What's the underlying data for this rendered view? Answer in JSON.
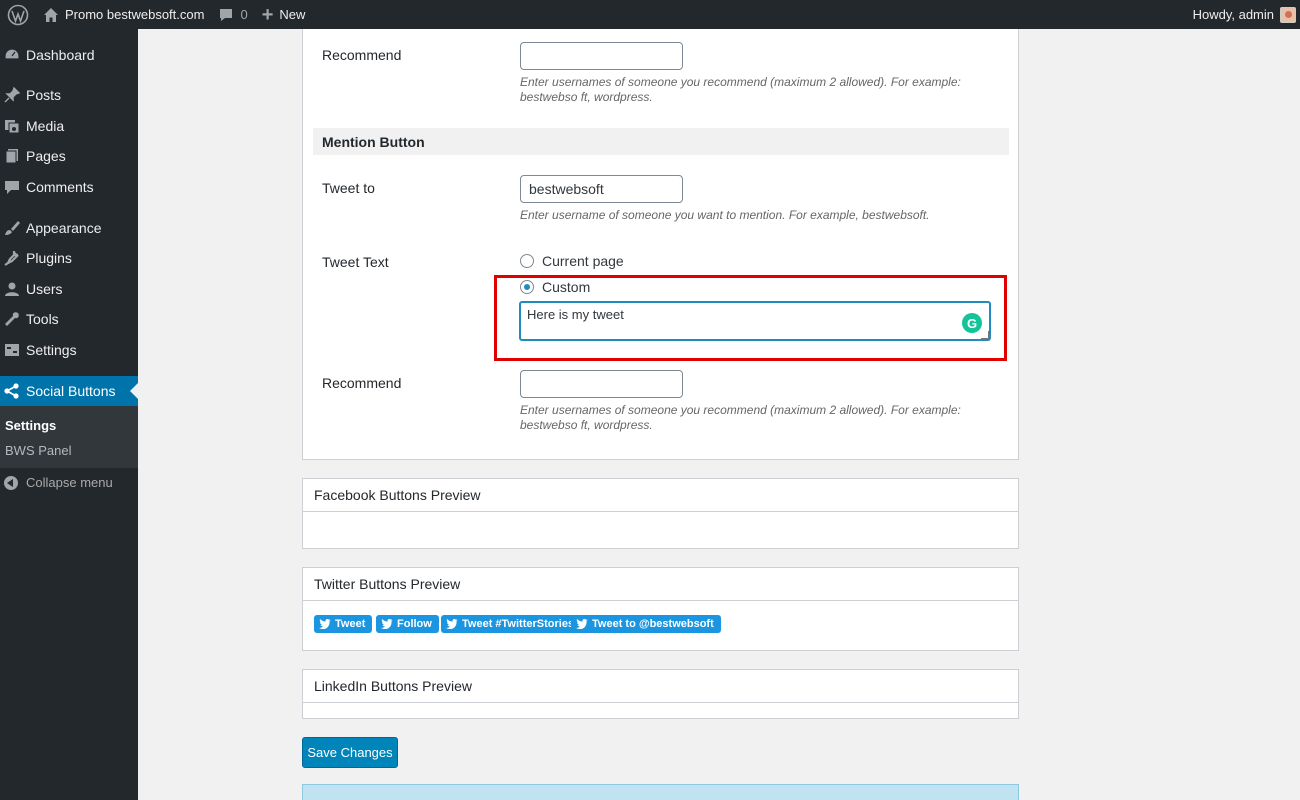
{
  "adminbar": {
    "site_name": "Promo bestwebsoft.com",
    "comments_count": "0",
    "new_label": "New",
    "greeting": "Howdy, admin"
  },
  "sidebar": {
    "items": [
      {
        "label": "Dashboard",
        "icon": "dashboard-icon"
      },
      {
        "label": "Posts",
        "icon": "pin-icon"
      },
      {
        "label": "Media",
        "icon": "media-icon"
      },
      {
        "label": "Pages",
        "icon": "pages-icon"
      },
      {
        "label": "Comments",
        "icon": "comment-icon"
      },
      {
        "label": "Appearance",
        "icon": "brush-icon"
      },
      {
        "label": "Plugins",
        "icon": "plugin-icon"
      },
      {
        "label": "Users",
        "icon": "user-icon"
      },
      {
        "label": "Tools",
        "icon": "wrench-icon"
      },
      {
        "label": "Settings",
        "icon": "settings-icon"
      },
      {
        "label": "Social Buttons",
        "icon": "share-icon"
      }
    ],
    "submenu": [
      "Settings",
      "BWS Panel"
    ],
    "collapse_label": "Collapse menu"
  },
  "form": {
    "recommend_top": {
      "label": "Recommend",
      "value": "",
      "description": "Enter usernames of someone you recommend (maximum 2 allowed). For example: bestwebso ft, wordpress."
    },
    "mention_section_title": "Mention Button",
    "tweet_to": {
      "label": "Tweet to",
      "value": "bestwebsoft",
      "description": "Enter username of someone you want to mention. For example, bestwebsoft."
    },
    "tweet_text": {
      "label": "Tweet Text",
      "option_current": "Current page",
      "option_custom": "Custom",
      "selected": "Custom",
      "custom_value": "Here is my tweet"
    },
    "recommend_bottom": {
      "label": "Recommend",
      "value": "",
      "description": "Enter usernames of someone you recommend (maximum 2 allowed). For example: bestwebso ft, wordpress."
    }
  },
  "previews": {
    "facebook_title": "Facebook Buttons Preview",
    "twitter_title": "Twitter Buttons Preview",
    "linkedin_title": "LinkedIn Buttons Preview",
    "twitter_buttons": [
      "Tweet",
      "Follow",
      "Tweet #TwitterStories",
      "Tweet to @bestwebsoft"
    ]
  },
  "save_label": "Save Changes",
  "colors": {
    "admin_bar": "#23282d",
    "active_menu": "#0073aa",
    "twitter_blue": "#1b95e0",
    "highlight_red": "#e00000",
    "primary_button": "#0085ba"
  }
}
